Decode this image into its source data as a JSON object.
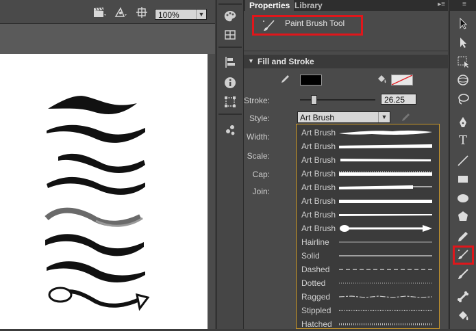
{
  "stage": {
    "zoom": "100%"
  },
  "panel": {
    "tabs": [
      {
        "label": "Properties"
      },
      {
        "label": "Library"
      }
    ],
    "tool_name": "Paint Brush Tool",
    "section": "Fill and Stroke",
    "fill_color": "#000000",
    "stroke_label": "Stroke:",
    "stroke_value": "26.25",
    "style_label": "Style:",
    "style_value": "Art Brush",
    "width_label": "Width:",
    "scale_label": "Scale:",
    "cap_label": "Cap:",
    "join_label": "Join:",
    "style_options": [
      {
        "label": "Art Brush"
      },
      {
        "label": "Art Brush"
      },
      {
        "label": "Art Brush"
      },
      {
        "label": "Art Brush"
      },
      {
        "label": "Art Brush"
      },
      {
        "label": "Art Brush"
      },
      {
        "label": "Art Brush"
      },
      {
        "label": "Art Brush"
      },
      {
        "label": "Hairline"
      },
      {
        "label": "Solid"
      },
      {
        "label": "Dashed"
      },
      {
        "label": "Dotted"
      },
      {
        "label": "Ragged"
      },
      {
        "label": "Stippled"
      },
      {
        "label": "Hatched"
      }
    ]
  },
  "colors": {
    "highlight": "#e0161b",
    "dropdown_border": "#c9972a"
  }
}
